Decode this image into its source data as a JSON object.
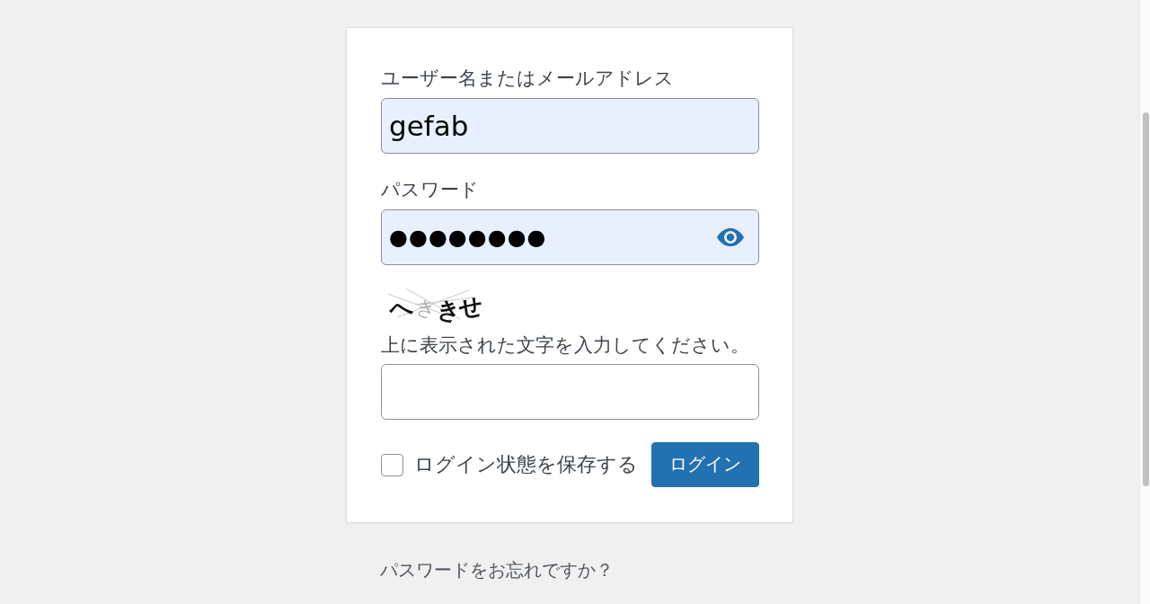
{
  "login_form": {
    "fields": [
      {
        "kind": "text",
        "label": "ユーザー名またはメールアドレス",
        "value": "gefab",
        "autofilled": true
      },
      {
        "kind": "password",
        "label": "パスワード",
        "value": "●●●●●●●●",
        "autofilled": true
      },
      {
        "kind": "captcha",
        "captcha_text": "へききせ",
        "label": "上に表示された文字を入力してください。",
        "autofilled": false
      }
    ],
    "remember_me": {
      "label": "ログイン状態を保存する",
      "checked": false
    },
    "submit_button": {
      "label": "ログイン"
    }
  },
  "lost_password_link": "パスワードをお忘れですか？"
}
